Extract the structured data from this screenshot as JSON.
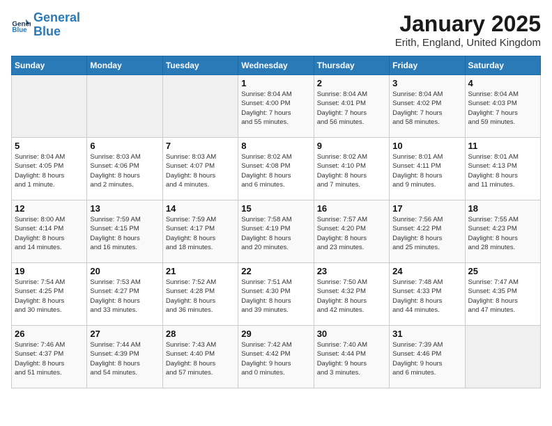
{
  "header": {
    "logo_line1": "General",
    "logo_line2": "Blue",
    "month": "January 2025",
    "location": "Erith, England, United Kingdom"
  },
  "weekdays": [
    "Sunday",
    "Monday",
    "Tuesday",
    "Wednesday",
    "Thursday",
    "Friday",
    "Saturday"
  ],
  "weeks": [
    [
      {
        "day": "",
        "info": ""
      },
      {
        "day": "",
        "info": ""
      },
      {
        "day": "",
        "info": ""
      },
      {
        "day": "1",
        "info": "Sunrise: 8:04 AM\nSunset: 4:00 PM\nDaylight: 7 hours\nand 55 minutes."
      },
      {
        "day": "2",
        "info": "Sunrise: 8:04 AM\nSunset: 4:01 PM\nDaylight: 7 hours\nand 56 minutes."
      },
      {
        "day": "3",
        "info": "Sunrise: 8:04 AM\nSunset: 4:02 PM\nDaylight: 7 hours\nand 58 minutes."
      },
      {
        "day": "4",
        "info": "Sunrise: 8:04 AM\nSunset: 4:03 PM\nDaylight: 7 hours\nand 59 minutes."
      }
    ],
    [
      {
        "day": "5",
        "info": "Sunrise: 8:04 AM\nSunset: 4:05 PM\nDaylight: 8 hours\nand 1 minute."
      },
      {
        "day": "6",
        "info": "Sunrise: 8:03 AM\nSunset: 4:06 PM\nDaylight: 8 hours\nand 2 minutes."
      },
      {
        "day": "7",
        "info": "Sunrise: 8:03 AM\nSunset: 4:07 PM\nDaylight: 8 hours\nand 4 minutes."
      },
      {
        "day": "8",
        "info": "Sunrise: 8:02 AM\nSunset: 4:08 PM\nDaylight: 8 hours\nand 6 minutes."
      },
      {
        "day": "9",
        "info": "Sunrise: 8:02 AM\nSunset: 4:10 PM\nDaylight: 8 hours\nand 7 minutes."
      },
      {
        "day": "10",
        "info": "Sunrise: 8:01 AM\nSunset: 4:11 PM\nDaylight: 8 hours\nand 9 minutes."
      },
      {
        "day": "11",
        "info": "Sunrise: 8:01 AM\nSunset: 4:13 PM\nDaylight: 8 hours\nand 11 minutes."
      }
    ],
    [
      {
        "day": "12",
        "info": "Sunrise: 8:00 AM\nSunset: 4:14 PM\nDaylight: 8 hours\nand 14 minutes."
      },
      {
        "day": "13",
        "info": "Sunrise: 7:59 AM\nSunset: 4:15 PM\nDaylight: 8 hours\nand 16 minutes."
      },
      {
        "day": "14",
        "info": "Sunrise: 7:59 AM\nSunset: 4:17 PM\nDaylight: 8 hours\nand 18 minutes."
      },
      {
        "day": "15",
        "info": "Sunrise: 7:58 AM\nSunset: 4:19 PM\nDaylight: 8 hours\nand 20 minutes."
      },
      {
        "day": "16",
        "info": "Sunrise: 7:57 AM\nSunset: 4:20 PM\nDaylight: 8 hours\nand 23 minutes."
      },
      {
        "day": "17",
        "info": "Sunrise: 7:56 AM\nSunset: 4:22 PM\nDaylight: 8 hours\nand 25 minutes."
      },
      {
        "day": "18",
        "info": "Sunrise: 7:55 AM\nSunset: 4:23 PM\nDaylight: 8 hours\nand 28 minutes."
      }
    ],
    [
      {
        "day": "19",
        "info": "Sunrise: 7:54 AM\nSunset: 4:25 PM\nDaylight: 8 hours\nand 30 minutes."
      },
      {
        "day": "20",
        "info": "Sunrise: 7:53 AM\nSunset: 4:27 PM\nDaylight: 8 hours\nand 33 minutes."
      },
      {
        "day": "21",
        "info": "Sunrise: 7:52 AM\nSunset: 4:28 PM\nDaylight: 8 hours\nand 36 minutes."
      },
      {
        "day": "22",
        "info": "Sunrise: 7:51 AM\nSunset: 4:30 PM\nDaylight: 8 hours\nand 39 minutes."
      },
      {
        "day": "23",
        "info": "Sunrise: 7:50 AM\nSunset: 4:32 PM\nDaylight: 8 hours\nand 42 minutes."
      },
      {
        "day": "24",
        "info": "Sunrise: 7:48 AM\nSunset: 4:33 PM\nDaylight: 8 hours\nand 44 minutes."
      },
      {
        "day": "25",
        "info": "Sunrise: 7:47 AM\nSunset: 4:35 PM\nDaylight: 8 hours\nand 47 minutes."
      }
    ],
    [
      {
        "day": "26",
        "info": "Sunrise: 7:46 AM\nSunset: 4:37 PM\nDaylight: 8 hours\nand 51 minutes."
      },
      {
        "day": "27",
        "info": "Sunrise: 7:44 AM\nSunset: 4:39 PM\nDaylight: 8 hours\nand 54 minutes."
      },
      {
        "day": "28",
        "info": "Sunrise: 7:43 AM\nSunset: 4:40 PM\nDaylight: 8 hours\nand 57 minutes."
      },
      {
        "day": "29",
        "info": "Sunrise: 7:42 AM\nSunset: 4:42 PM\nDaylight: 9 hours\nand 0 minutes."
      },
      {
        "day": "30",
        "info": "Sunrise: 7:40 AM\nSunset: 4:44 PM\nDaylight: 9 hours\nand 3 minutes."
      },
      {
        "day": "31",
        "info": "Sunrise: 7:39 AM\nSunset: 4:46 PM\nDaylight: 9 hours\nand 6 minutes."
      },
      {
        "day": "",
        "info": ""
      }
    ]
  ]
}
